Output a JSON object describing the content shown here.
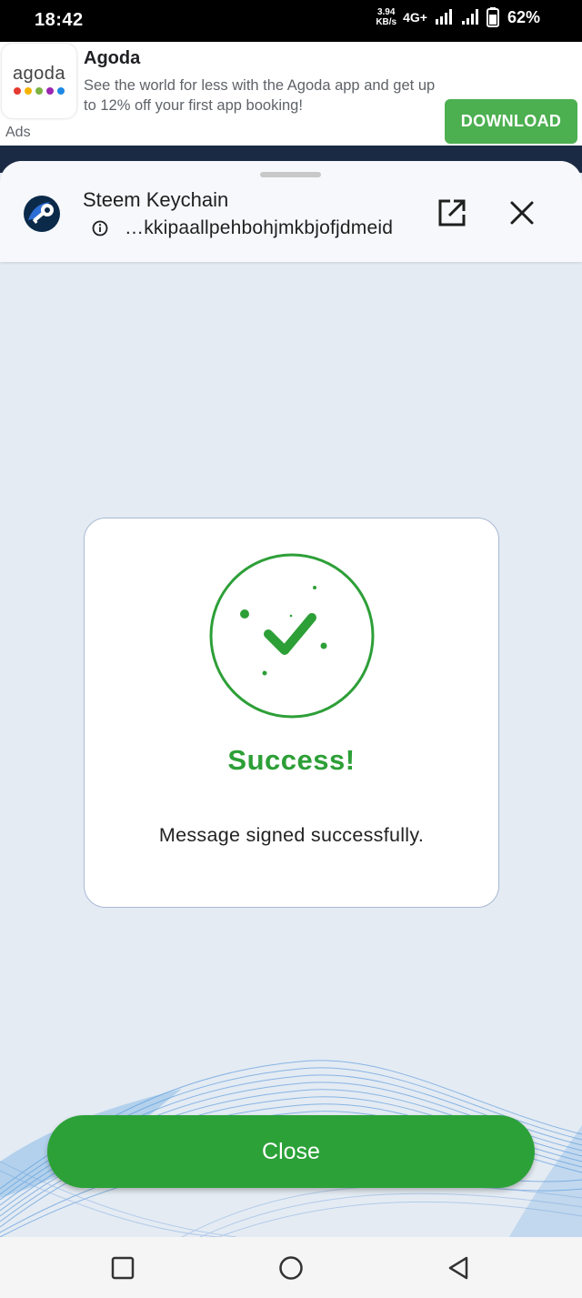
{
  "status_bar": {
    "time": "18:42",
    "speed_value": "3.94",
    "speed_unit": "KB/s",
    "network": "4G+",
    "battery": "62%"
  },
  "ad": {
    "logo_text": "agoda",
    "logo_dot_colors": [
      "#e43a2f",
      "#f4b400",
      "#7cb342",
      "#9c27b0",
      "#1e88e5"
    ],
    "title": "Agoda",
    "description": "See the world for less with the Agoda app and get up to 12% off your first app booking!",
    "label": "Ads",
    "button": "DOWNLOAD"
  },
  "sheet": {
    "app_title": "Steem Keychain",
    "url": "…kkipaallpehbohjmkbjofjdmeid",
    "icons": [
      "info-icon",
      "open-external-icon",
      "close-icon"
    ]
  },
  "result": {
    "title": "Success!",
    "message": "Message signed successfully.",
    "accent_color": "#2d9f37"
  },
  "actions": {
    "close_label": "Close"
  },
  "nav": {
    "icons": [
      "recent-apps-icon",
      "home-icon",
      "back-icon"
    ]
  }
}
